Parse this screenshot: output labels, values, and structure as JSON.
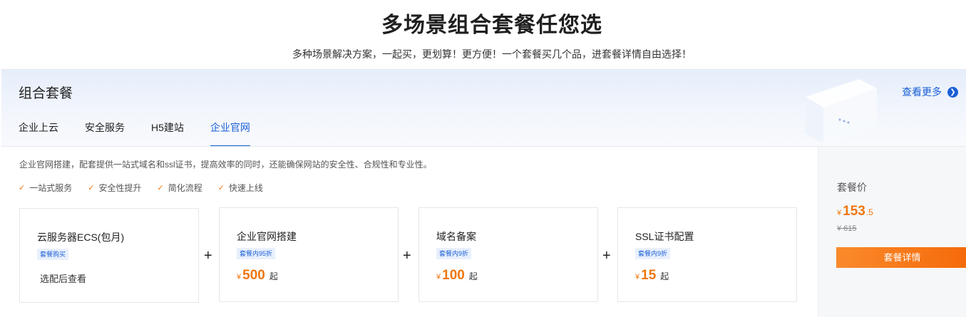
{
  "header": {
    "title": "多场景组合套餐任您选",
    "subtitle": "多种场景解决方案，一起买，更划算！更方便！一个套餐买几个品，进套餐详情自由选择！"
  },
  "panel": {
    "title": "组合套餐",
    "more_label": "查看更多",
    "more_icon": "chevron-right-circle-icon",
    "tabs": [
      {
        "label": "企业上云",
        "active": false
      },
      {
        "label": "安全服务",
        "active": false
      },
      {
        "label": "H5建站",
        "active": false
      },
      {
        "label": "企业官网",
        "active": true
      }
    ],
    "description": "企业官网搭建，配套提供一站式域名和ssl证书，提高效率的同时，还能确保网站的安全性、合规性和专业性。",
    "features": [
      "一站式服务",
      "安全性提升",
      "简化流程",
      "快速上线"
    ],
    "feature_icon": "check-icon",
    "cards": [
      {
        "name": "云服务器ECS(包月)",
        "badge": "套餐购买",
        "view_text": "选配后查看"
      },
      {
        "name": "企业官网搭建",
        "badge": "套餐内95折",
        "currency": "¥",
        "price": "500",
        "suffix": "起"
      },
      {
        "name": "域名备案",
        "badge": "套餐内9折",
        "currency": "¥",
        "price": "100",
        "suffix": "起"
      },
      {
        "name": "SSL证书配置",
        "badge": "套餐内9折",
        "currency": "¥",
        "price": "15",
        "suffix": "起"
      }
    ],
    "plus_sign": "+",
    "summary": {
      "label": "套餐价",
      "currency": "¥",
      "price_int": "153",
      "price_dec": ".5",
      "original_price": "¥ 615",
      "button_label": "套餐详情"
    }
  },
  "colors": {
    "accent_blue": "#1a5fd6",
    "accent_orange": "#f0760e"
  }
}
